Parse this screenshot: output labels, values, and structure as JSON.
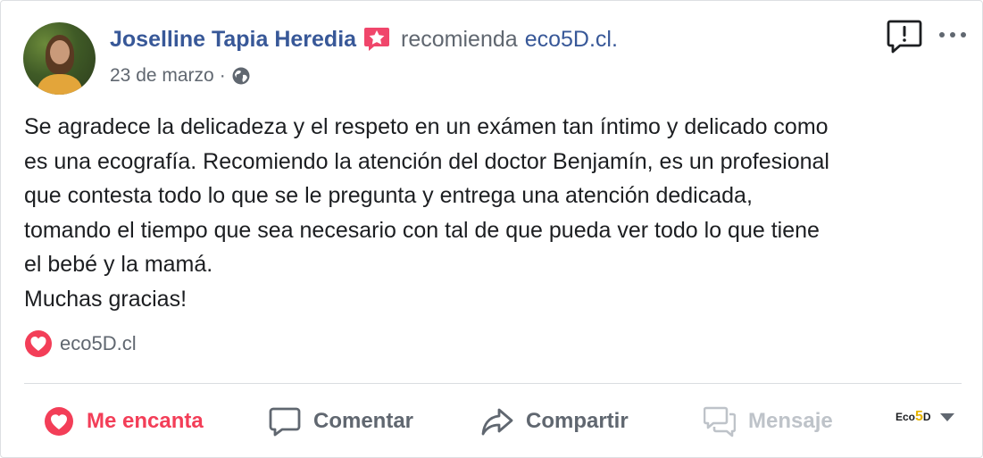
{
  "post": {
    "author": "Joselline Tapia Heredia",
    "recommends_label": "recomienda",
    "page_name": "eco5D.cl.",
    "date": "23 de marzo",
    "separator": "·",
    "text_lines": [
      "Se agradece la delicadeza y el respeto en un exámen tan íntimo y delicado como",
      "es una ecografía. Recomiendo la atención del doctor Benjamín, es un profesional",
      "que contesta todo lo que se le pregunta y entrega una atención dedicada,",
      "tomando el tiempo que sea necesario con tal de que pueda ver todo lo que tiene",
      "el bebé y la mamá.",
      "Muchas gracias!"
    ]
  },
  "reactions": {
    "reactor": "eco5D.cl"
  },
  "actions": {
    "love": "Me encanta",
    "comment": "Comentar",
    "share": "Compartir",
    "message": "Mensaje"
  },
  "page_selector": {
    "logo_prefix": "Eco",
    "logo_five": "5",
    "logo_suffix": "D"
  },
  "colors": {
    "link_blue": "#385898",
    "love_red": "#f33e58",
    "gray_text": "#606770",
    "disabled_gray": "#bec3c9"
  },
  "icons": [
    "recommendation-star-icon",
    "globe-icon",
    "report-icon",
    "more-options-icon",
    "love-reaction-icon",
    "comment-icon",
    "share-icon",
    "message-icon",
    "chevron-down-icon"
  ]
}
